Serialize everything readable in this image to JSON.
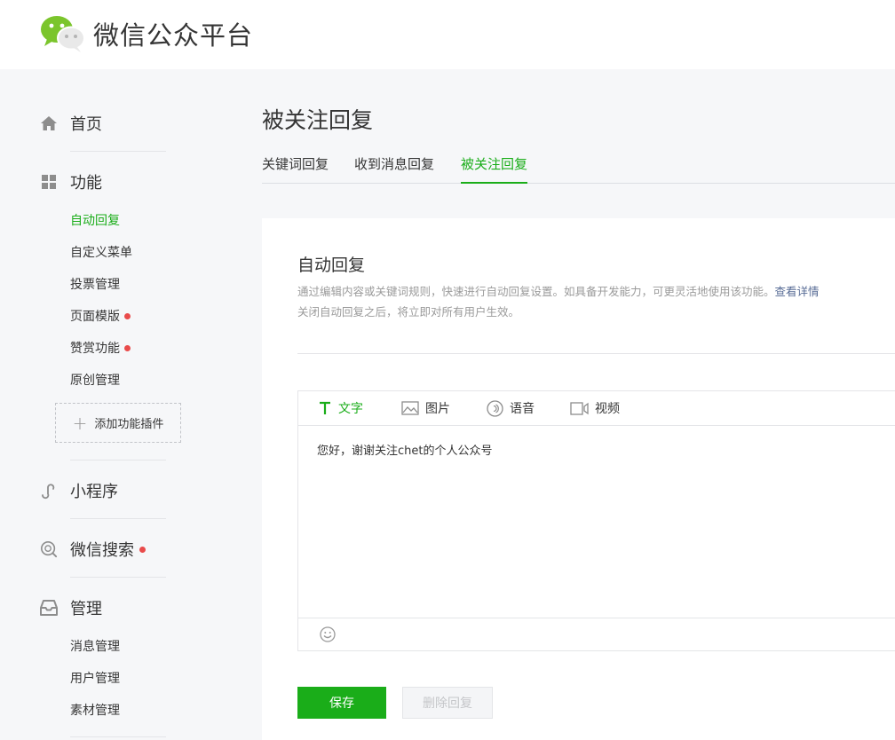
{
  "header": {
    "brand": "微信公众平台"
  },
  "sidebar": {
    "home": "首页",
    "features": {
      "label": "功能",
      "items": [
        {
          "label": "自动回复",
          "active": true,
          "dot": false
        },
        {
          "label": "自定义菜单",
          "active": false,
          "dot": false
        },
        {
          "label": "投票管理",
          "active": false,
          "dot": false
        },
        {
          "label": "页面模版",
          "active": false,
          "dot": true
        },
        {
          "label": "赞赏功能",
          "active": false,
          "dot": true
        },
        {
          "label": "原创管理",
          "active": false,
          "dot": false
        }
      ],
      "add_plugin": "添加功能插件"
    },
    "miniprogram": "小程序",
    "wechat_search": "微信搜索",
    "manage": {
      "label": "管理",
      "items": [
        {
          "label": "消息管理"
        },
        {
          "label": "用户管理"
        },
        {
          "label": "素材管理"
        }
      ]
    }
  },
  "main": {
    "title": "被关注回复",
    "tabs": [
      {
        "label": "关键词回复",
        "active": false
      },
      {
        "label": "收到消息回复",
        "active": false
      },
      {
        "label": "被关注回复",
        "active": true
      }
    ],
    "panel": {
      "title": "自动回复",
      "desc1": "通过编辑内容或关键词规则，快速进行自动回复设置。如具备开发能力，可更灵活地使用该功能。",
      "desc_link": "查看详情",
      "desc2": "关闭自动回复之后，将立即对所有用户生效。",
      "editor_tools": [
        {
          "label": "文字",
          "icon": "text-icon",
          "active": true
        },
        {
          "label": "图片",
          "icon": "image-icon",
          "active": false
        },
        {
          "label": "语音",
          "icon": "voice-icon",
          "active": false
        },
        {
          "label": "视频",
          "icon": "video-icon",
          "active": false
        }
      ],
      "content": "您好，谢谢关注chet的个人公众号",
      "save_label": "保存",
      "delete_label": "删除回复"
    }
  },
  "colors": {
    "accent": "#1aad19",
    "dot": "#e94b4b",
    "link": "#576b95"
  }
}
